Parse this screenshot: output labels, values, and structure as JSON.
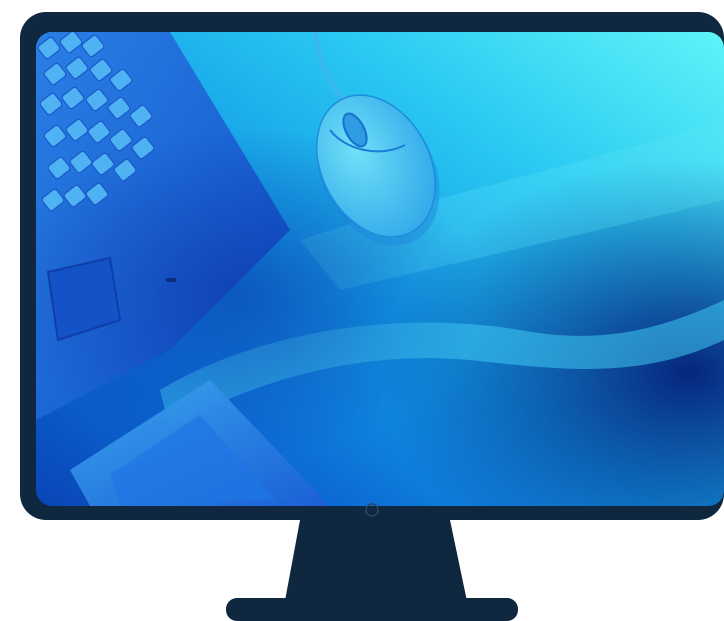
{
  "illustration": {
    "subject": "desktop-monitor",
    "screen_content": "photo-laptop-and-mouse",
    "colors": {
      "frame": "#10283F",
      "screen_highlight": "#5FF4F8",
      "screen_mid": "#1EAEEA",
      "screen_deep": "#0A4FC4",
      "screen_dark": "#062A8E",
      "background": "#FFFFFF"
    },
    "icons": [
      "monitor-icon",
      "computer-mouse-icon",
      "laptop-icon"
    ]
  }
}
